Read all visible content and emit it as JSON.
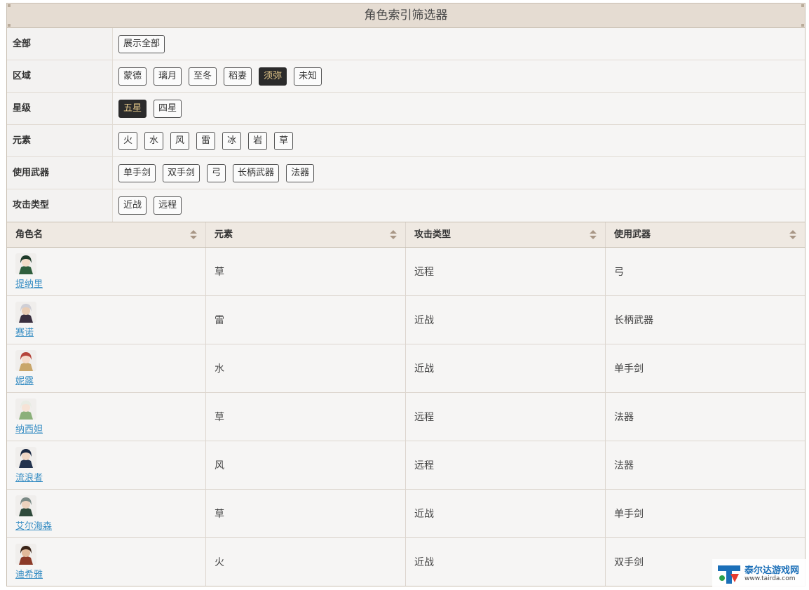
{
  "panel": {
    "title": "角色索引筛选器"
  },
  "filters": [
    {
      "label": "全部",
      "options": [
        {
          "text": "展示全部",
          "active": false
        }
      ]
    },
    {
      "label": "区域",
      "options": [
        {
          "text": "蒙德",
          "active": false
        },
        {
          "text": "璃月",
          "active": false
        },
        {
          "text": "至冬",
          "active": false
        },
        {
          "text": "稻妻",
          "active": false
        },
        {
          "text": "须弥",
          "active": true
        },
        {
          "text": "未知",
          "active": false
        }
      ]
    },
    {
      "label": "星级",
      "options": [
        {
          "text": "五星",
          "active": true
        },
        {
          "text": "四星",
          "active": false
        }
      ]
    },
    {
      "label": "元素",
      "options": [
        {
          "text": "火",
          "active": false
        },
        {
          "text": "水",
          "active": false
        },
        {
          "text": "风",
          "active": false
        },
        {
          "text": "雷",
          "active": false
        },
        {
          "text": "冰",
          "active": false
        },
        {
          "text": "岩",
          "active": false
        },
        {
          "text": "草",
          "active": false
        }
      ]
    },
    {
      "label": "使用武器",
      "options": [
        {
          "text": "单手剑",
          "active": false
        },
        {
          "text": "双手剑",
          "active": false
        },
        {
          "text": "弓",
          "active": false
        },
        {
          "text": "长柄武器",
          "active": false
        },
        {
          "text": "法器",
          "active": false
        }
      ]
    },
    {
      "label": "攻击类型",
      "options": [
        {
          "text": "近战",
          "active": false
        },
        {
          "text": "远程",
          "active": false
        }
      ]
    }
  ],
  "table": {
    "headers": [
      "角色名",
      "元素",
      "攻击类型",
      "使用武器"
    ],
    "rows": [
      {
        "name": "提纳里",
        "element": "草",
        "attack": "远程",
        "weapon": "弓",
        "avatar": {
          "hair": "#1f3b2a",
          "skin": "#f3dcc8",
          "cloth": "#2f5e3c"
        }
      },
      {
        "name": "赛诺",
        "element": "雷",
        "attack": "近战",
        "weapon": "长柄武器",
        "avatar": {
          "hair": "#cfcfd6",
          "skin": "#e9cdb5",
          "cloth": "#3a2f3f"
        }
      },
      {
        "name": "妮露",
        "element": "水",
        "attack": "近战",
        "weapon": "单手剑",
        "avatar": {
          "hair": "#b5443a",
          "skin": "#f5dccc",
          "cloth": "#c9a66a"
        }
      },
      {
        "name": "纳西妲",
        "element": "草",
        "attack": "远程",
        "weapon": "法器",
        "avatar": {
          "hair": "#e8ece4",
          "skin": "#f6e3d6",
          "cloth": "#8bb07a"
        }
      },
      {
        "name": "流浪者",
        "element": "风",
        "attack": "远程",
        "weapon": "法器",
        "avatar": {
          "hair": "#1c2a44",
          "skin": "#efd6c5",
          "cloth": "#24344f"
        }
      },
      {
        "name": "艾尔海森",
        "element": "草",
        "attack": "近战",
        "weapon": "单手剑",
        "avatar": {
          "hair": "#7b8a86",
          "skin": "#ecd2be",
          "cloth": "#2f4a3b"
        }
      },
      {
        "name": "迪希雅",
        "element": "火",
        "attack": "近战",
        "weapon": "双手剑",
        "avatar": {
          "hair": "#3a2418",
          "skin": "#e2b99a",
          "cloth": "#8c3a28"
        }
      }
    ]
  },
  "watermark": {
    "title": "泰尔达游戏网",
    "url": "www.tairda.com"
  },
  "colors": {
    "accent_text": "#e6c98a",
    "active_bg": "#2b2b2b",
    "link": "#3a8fc4",
    "header_bg": "#e5dcd2"
  }
}
